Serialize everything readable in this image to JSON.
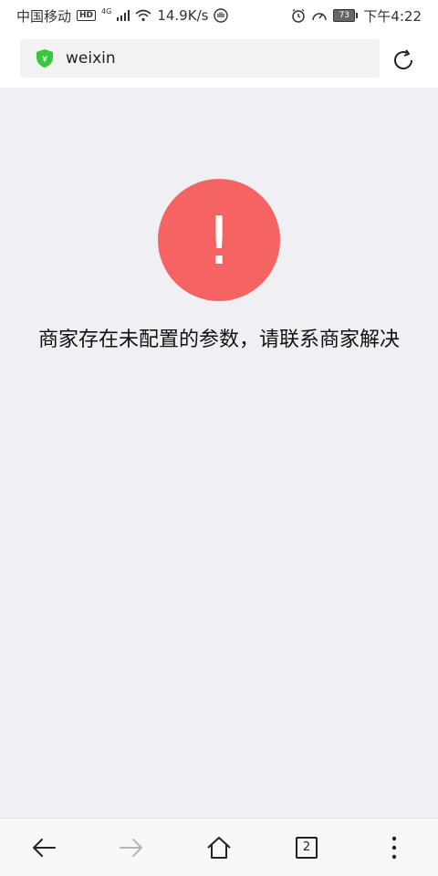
{
  "status_bar": {
    "carrier": "中国移动",
    "hd_badge": "HD",
    "network_type": "4G",
    "speed": "14.9K/s",
    "battery_level": "73",
    "time": "下午4:22"
  },
  "address_bar": {
    "url": "weixin",
    "shield_glyph": "¥"
  },
  "error": {
    "icon_symbol": "!",
    "message": "商家存在未配置的参数，请联系商家解决",
    "color": "#f56363"
  },
  "toolbar": {
    "tabs_count": "2"
  }
}
